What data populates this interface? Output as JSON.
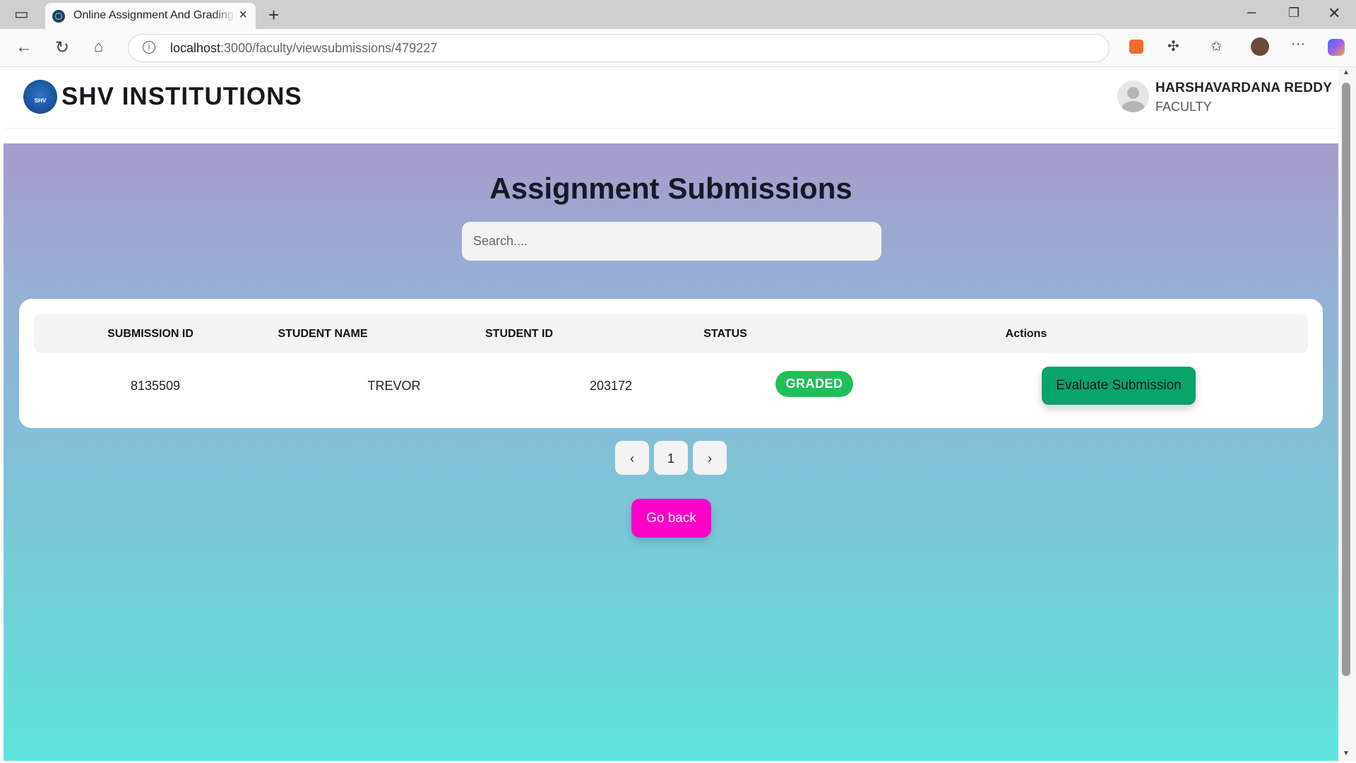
{
  "browser": {
    "tab_title": "Online Assignment And Grading System",
    "url_host": "localhost",
    "url_path": ":3000/faculty/viewsubmissions/479227"
  },
  "header": {
    "brand": "SHV INSTITUTIONS",
    "logo_text": "SHV",
    "user_name": "HARSHAVARDANA REDDY",
    "user_role": "FACULTY"
  },
  "main": {
    "title": "Assignment Submissions",
    "search_placeholder": "Search....",
    "columns": [
      "SUBMISSION ID",
      "STUDENT NAME",
      "STUDENT ID",
      "STATUS",
      "Actions"
    ],
    "rows": [
      {
        "submission_id": "8135509",
        "student_name": "TREVOR",
        "student_id": "203172",
        "status": "GRADED",
        "action_label": "Evaluate Submission"
      }
    ],
    "pagination": {
      "prev": "‹",
      "current": "1",
      "next": "›"
    },
    "go_back_label": "Go back"
  },
  "colors": {
    "status_graded": "#1fc05a",
    "evaluate_button": "#0aa36a",
    "go_back_button": "#ff00c8"
  },
  "icons": [
    "sidebar-toggle-icon",
    "close-icon",
    "new-tab-icon",
    "minimize-icon",
    "restore-icon",
    "back-icon",
    "reload-icon",
    "home-icon",
    "info-icon",
    "split-screen-icon",
    "zoom-icon",
    "more-tools-icon",
    "favorite-star-icon",
    "extension-icon",
    "favorites-icon",
    "profile-avatar-icon",
    "more-icon",
    "copilot-icon"
  ]
}
